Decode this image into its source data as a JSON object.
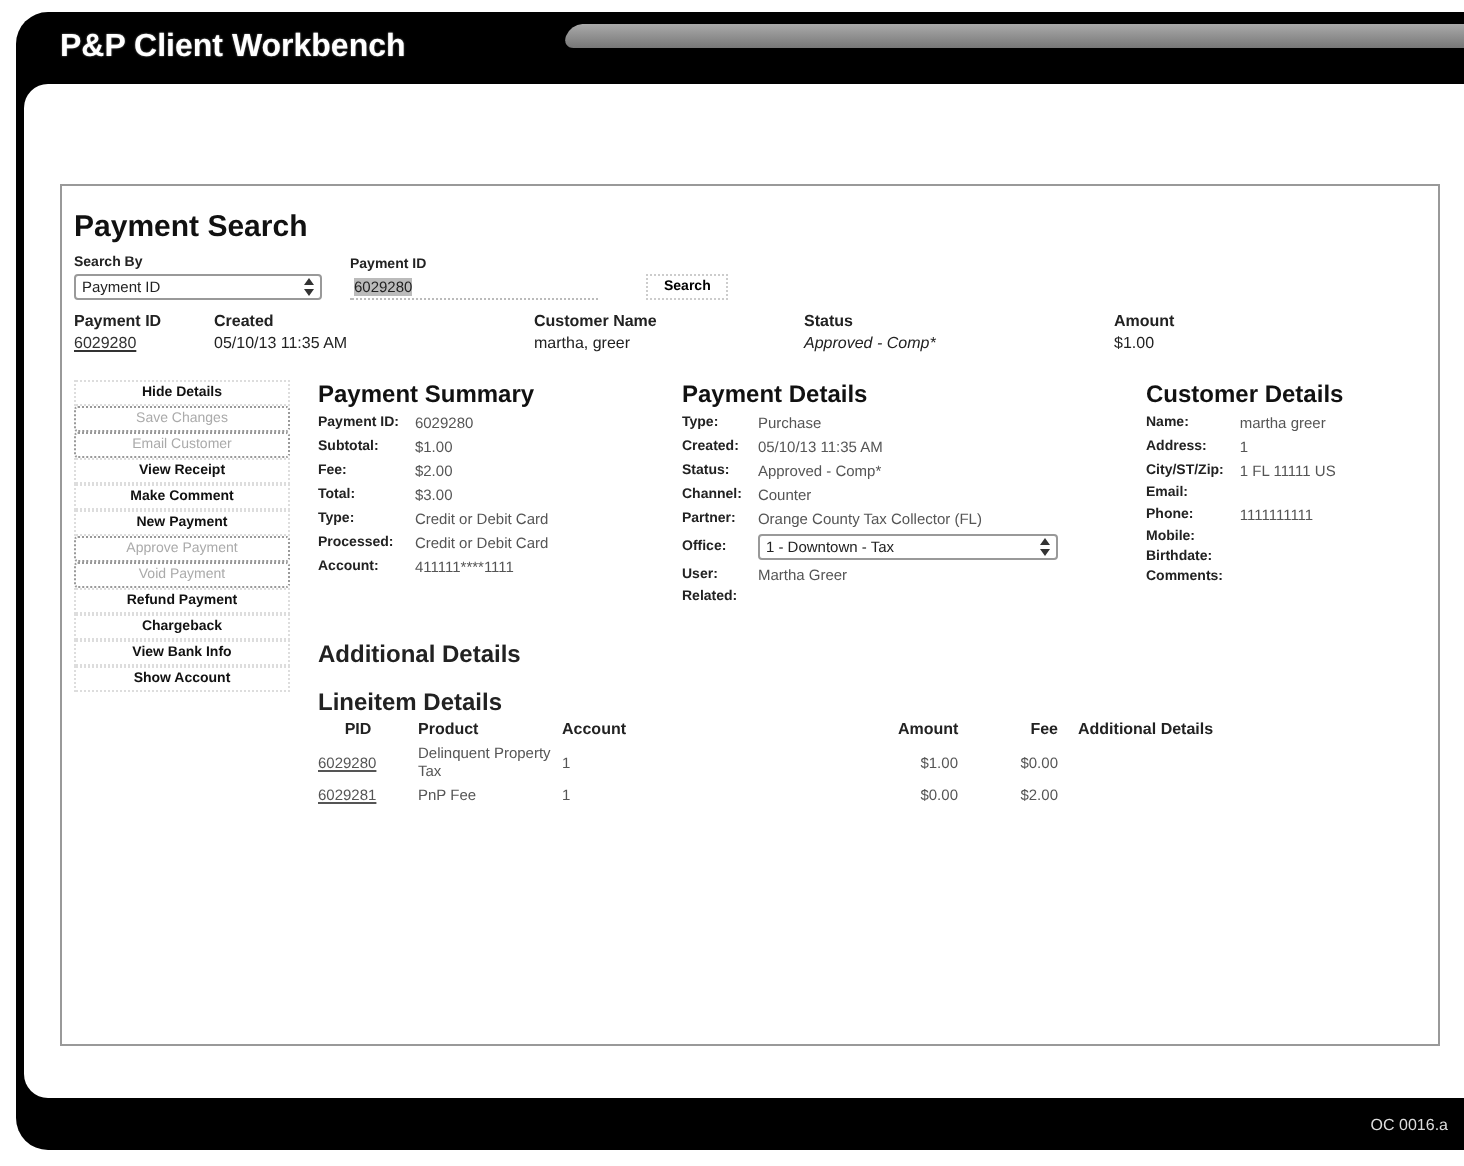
{
  "window": {
    "title": "P&P Client Workbench",
    "footer_code": "OC 0016.a"
  },
  "search": {
    "title": "Payment Search",
    "search_by": {
      "label": "Search By",
      "value": "Payment ID"
    },
    "payment_id": {
      "label": "Payment ID",
      "value": "6029280"
    },
    "button": "Search"
  },
  "results": {
    "columns": [
      "Payment ID",
      "Created",
      "Customer Name",
      "Status",
      "Amount"
    ],
    "rows": [
      [
        "6029280",
        "05/10/13 11:35 AM",
        "martha, greer",
        "Approved - Comp*",
        "$1.00"
      ]
    ]
  },
  "actions": [
    {
      "label": "Hide Details",
      "disabled": false
    },
    {
      "label": "Save Changes",
      "disabled": true
    },
    {
      "label": "Email Customer",
      "disabled": true
    },
    {
      "label": "View Receipt",
      "disabled": false
    },
    {
      "label": "Make Comment",
      "disabled": false
    },
    {
      "label": "New Payment",
      "disabled": false
    },
    {
      "label": "Approve Payment",
      "disabled": true
    },
    {
      "label": "Void Payment",
      "disabled": true
    },
    {
      "label": "Refund Payment",
      "disabled": false
    },
    {
      "label": "Chargeback",
      "disabled": false
    },
    {
      "label": "View Bank Info",
      "disabled": false
    },
    {
      "label": "Show Account",
      "disabled": false
    }
  ],
  "payment_summary": {
    "title": "Payment Summary",
    "fields": [
      {
        "label": "Payment ID:",
        "value": "6029280"
      },
      {
        "label": "Subtotal:",
        "value": "$1.00"
      },
      {
        "label": "Fee:",
        "value": "$2.00"
      },
      {
        "label": "Total:",
        "value": "$3.00"
      },
      {
        "label": "Type:",
        "value": "Credit or Debit Card"
      },
      {
        "label": "Processed:",
        "value": "Credit or Debit Card"
      },
      {
        "label": "Account:",
        "value": "411111****1111"
      }
    ]
  },
  "payment_details": {
    "title": "Payment Details",
    "fields": [
      {
        "label": "Type:",
        "value": "Purchase",
        "kind": "text"
      },
      {
        "label": "Created:",
        "value": "05/10/13 11:35 AM",
        "kind": "text"
      },
      {
        "label": "Status:",
        "value": "Approved - Comp*",
        "kind": "text"
      },
      {
        "label": "Channel:",
        "value": "Counter",
        "kind": "text"
      },
      {
        "label": "Partner:",
        "value": "Orange County Tax Collector (FL)",
        "kind": "text"
      },
      {
        "label": "Office:",
        "value": "1 - Downtown - Tax",
        "kind": "select"
      },
      {
        "label": "User:",
        "value": "Martha Greer",
        "kind": "text"
      },
      {
        "label": "Related:"
      }
    ]
  },
  "customer_details": {
    "title": "Customer Details",
    "fields": [
      {
        "label": "Name:",
        "value": "martha greer"
      },
      {
        "label": "Address:",
        "value": "1"
      },
      {
        "label": "City/ST/Zip:",
        "value": "1 FL 11111 US"
      },
      {
        "label": "Email:"
      },
      {
        "label": "Phone:",
        "value": "1111111111"
      },
      {
        "label": "Mobile:"
      },
      {
        "label": "Birthdate:"
      },
      {
        "label": "Comments:"
      }
    ]
  },
  "additional_details": {
    "title": "Additional Details"
  },
  "lineitems": {
    "title": "Lineitem Details",
    "columns": [
      "PID",
      "Product",
      "Account",
      "Amount",
      "Fee",
      "Additional Details"
    ],
    "rows": [
      {
        "pid": "6029280",
        "product": "Delinquent Property Tax",
        "account": "1",
        "amount": "$1.00",
        "fee": "$0.00"
      },
      {
        "pid": "6029281",
        "product": "PnP Fee",
        "account": "1",
        "amount": "$0.00",
        "fee": "$2.00"
      }
    ]
  }
}
